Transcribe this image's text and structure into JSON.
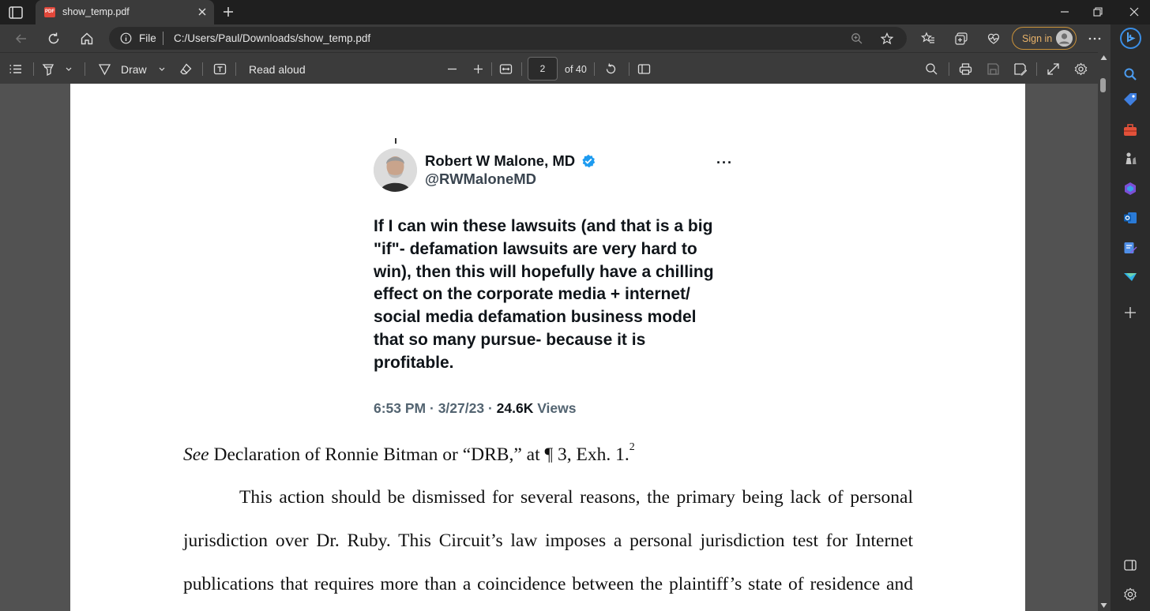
{
  "browser": {
    "tab_title": "show_temp.pdf",
    "tab_favicon": "PDF",
    "address_scheme_label": "File",
    "address_url": "C:/Users/Paul/Downloads/show_temp.pdf",
    "signin_label": "Sign in"
  },
  "pdf_toolbar": {
    "draw_label": "Draw",
    "read_aloud_label": "Read aloud",
    "page_current": "2",
    "page_total_label": "of 40"
  },
  "tweet": {
    "name": "Robert W Malone, MD",
    "handle": "@RWMaloneMD",
    "more": "···",
    "body_lines": [
      "If I can win these lawsuits (and that is a big",
      "\"if\"- defamation lawsuits are very hard to",
      "win), then this will hopefully have a chilling",
      "effect on the corporate media + internet/",
      "social media defamation business model",
      "that so many pursue- because it is",
      "profitable."
    ],
    "meta_time": "6:53 PM · 3/27/23 · ",
    "meta_views_count": "24.6K",
    "meta_views_label": " Views"
  },
  "document": {
    "see_italic": "See",
    "declaration_text": " Declaration of Ronnie Bitman or “DRB,” at ¶ 3, Exh. 1.",
    "footnote_ref": "2",
    "para_lines": [
      "This action should be dismissed for several reasons, the primary being lack of personal",
      "jurisdiction over Dr. Ruby. This Circuit’s law imposes a personal jurisdiction test for Internet",
      "publications that requires more than a coincidence between the plaintiff’s state of residence and"
    ]
  },
  "colors": {
    "verified_blue": "#1d9bf0",
    "signin_accent": "#e9b36a",
    "pdf_red": "#e2473a"
  }
}
